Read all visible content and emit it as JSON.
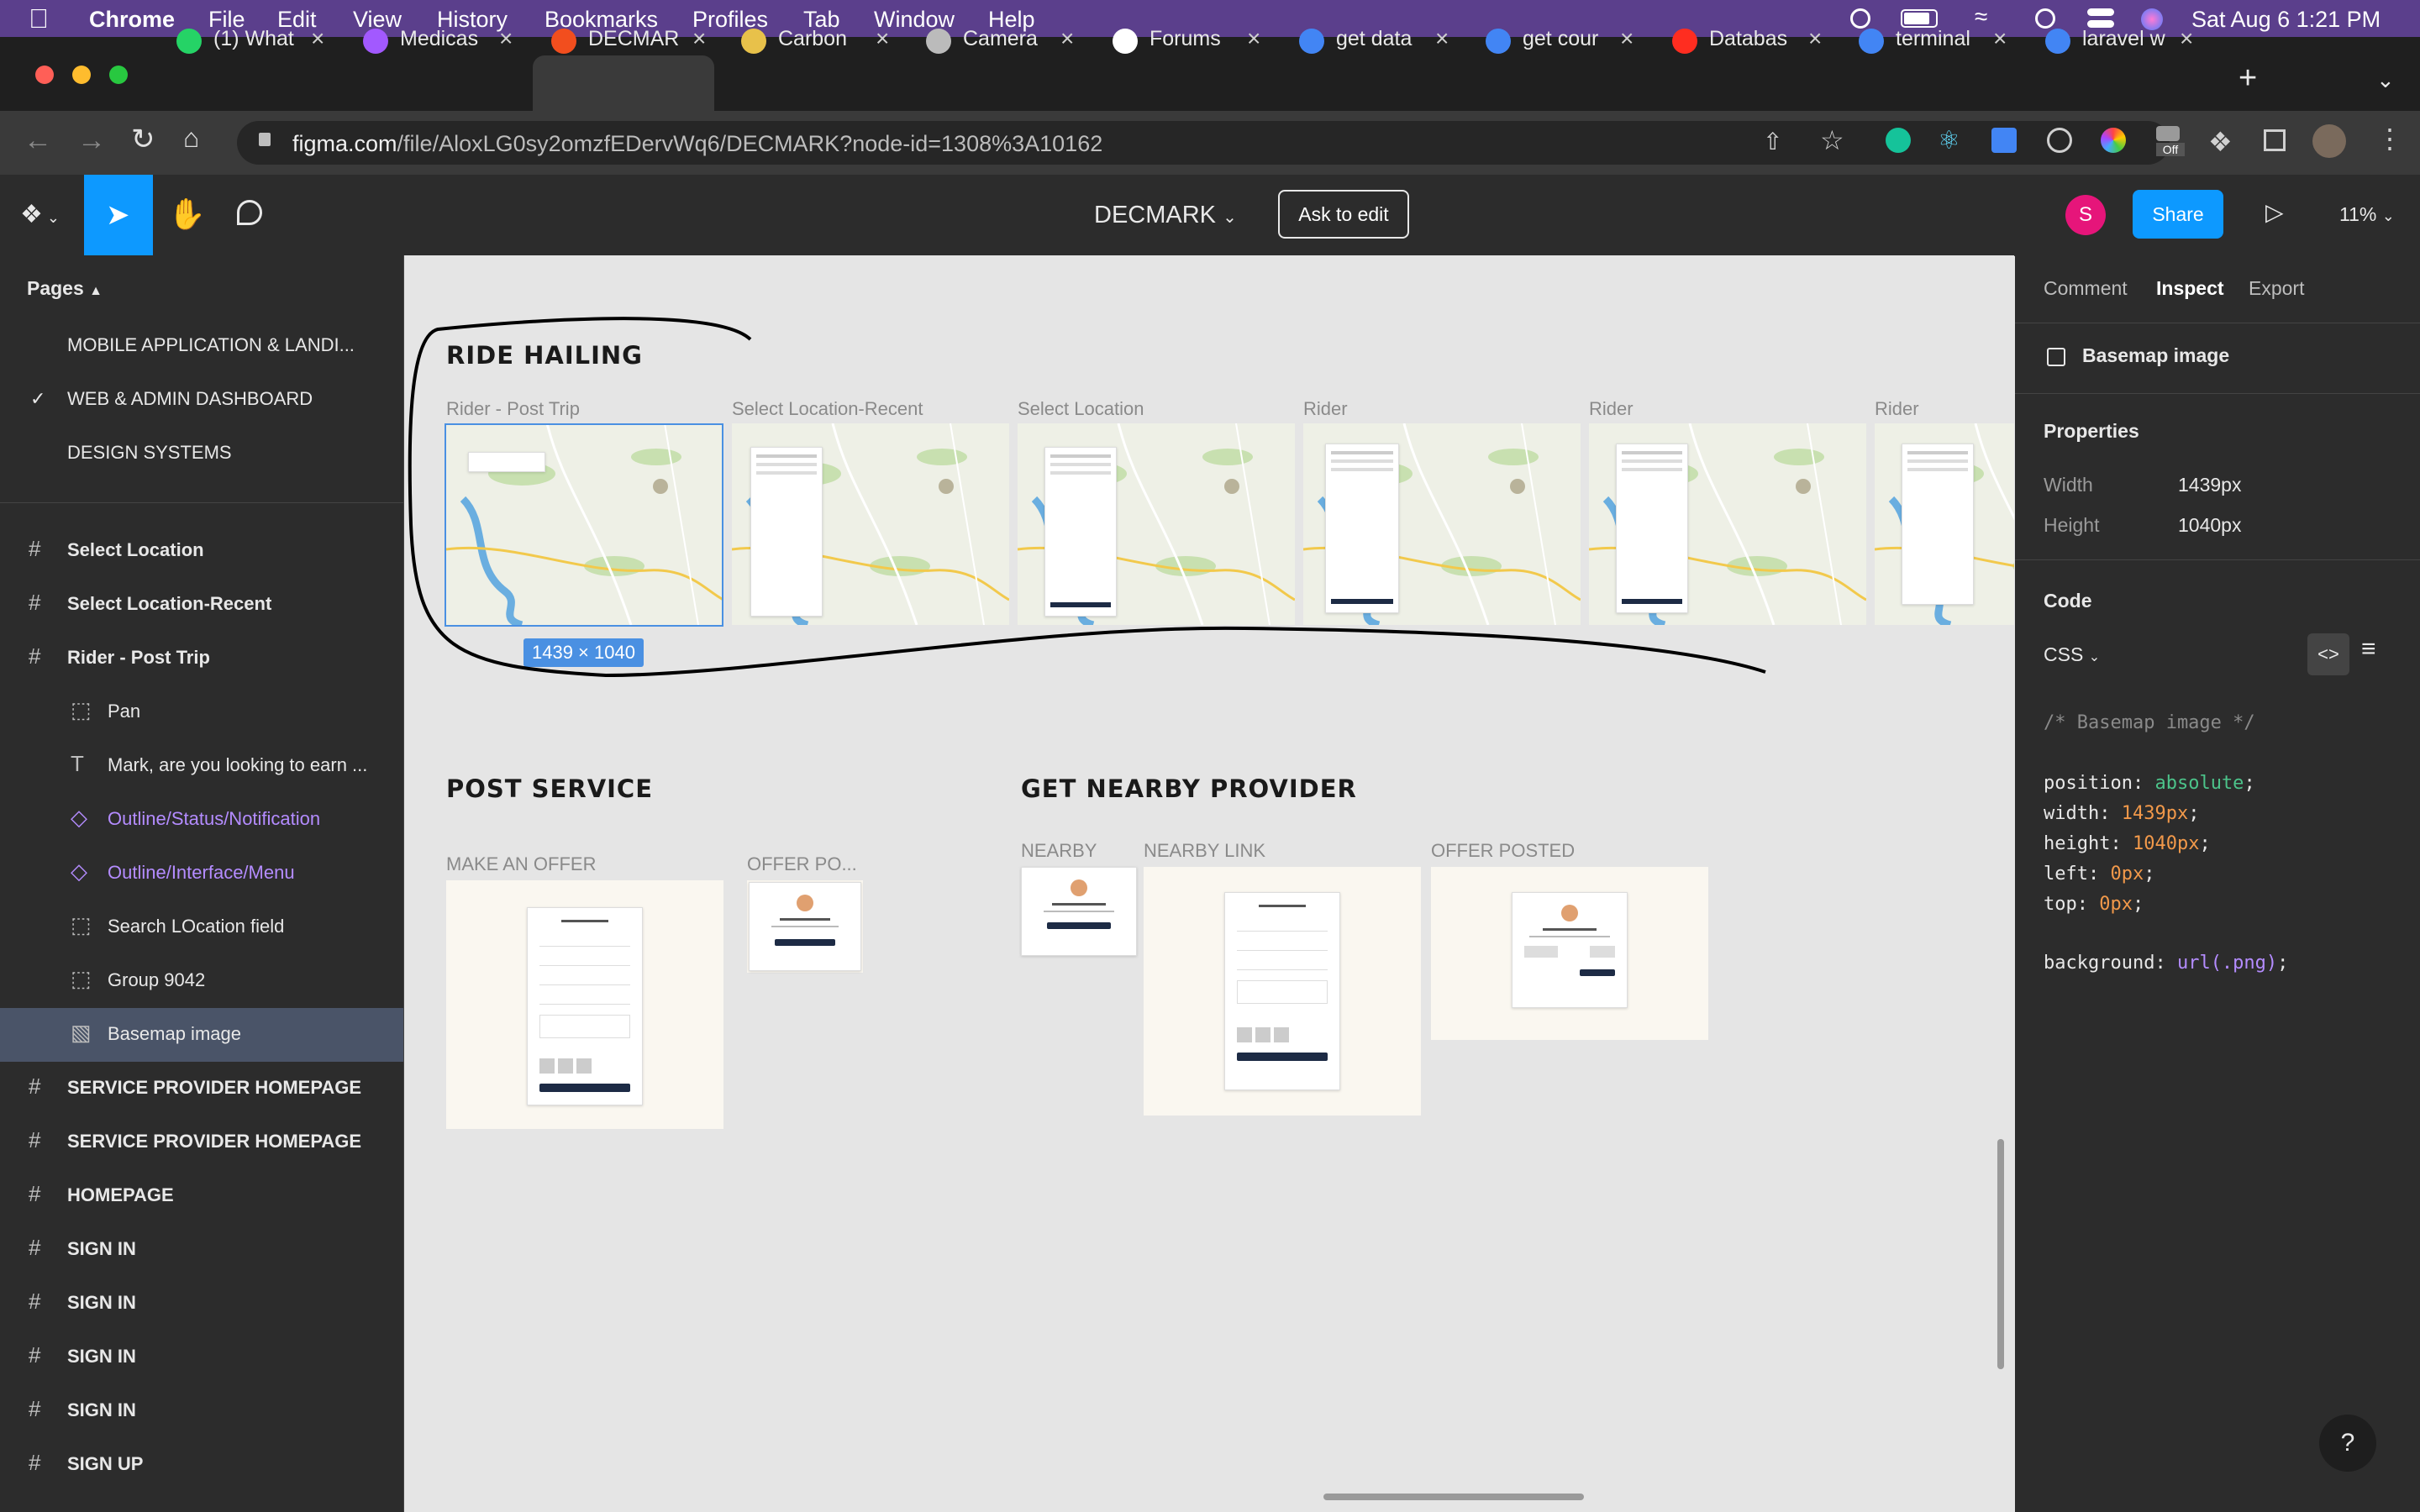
{
  "menubar": {
    "app": "Chrome",
    "items": [
      "File",
      "Edit",
      "View",
      "History",
      "Bookmarks",
      "Profiles",
      "Tab",
      "Window",
      "Help"
    ],
    "datetime": "Sat Aug 6  1:21 PM"
  },
  "tabs": [
    {
      "label": "(1) What",
      "color": "#25d366"
    },
    {
      "label": "Medicas",
      "color": "#a259ff"
    },
    {
      "label": "DECMAR",
      "color": "#f24e1e"
    },
    {
      "label": "Carbon",
      "color": "#e8c14a"
    },
    {
      "label": "Camera",
      "color": "#bbbbbb"
    },
    {
      "label": "Forums",
      "color": "#ffffff"
    },
    {
      "label": "get data",
      "color": "#4285f4"
    },
    {
      "label": "get cour",
      "color": "#4285f4"
    },
    {
      "label": "Databas",
      "color": "#ff2d20"
    },
    {
      "label": "terminal",
      "color": "#4285f4"
    },
    {
      "label": "laravel w",
      "color": "#4285f4"
    }
  ],
  "address": {
    "host": "figma.com",
    "path": "/file/AloxLG0sy2omzfEDervWq6/DECMARK?node-id=1308%3A10162"
  },
  "toolbar": {
    "file_name": "DECMARK",
    "ask_to_edit": "Ask to edit",
    "avatar_letter": "S",
    "share": "Share",
    "zoom": "11%"
  },
  "pages": {
    "header": "Pages",
    "items": [
      {
        "label": "MOBILE APPLICATION & LANDI...",
        "selected": false
      },
      {
        "label": "WEB & ADMIN DASHBOARD",
        "selected": true
      },
      {
        "label": "DESIGN SYSTEMS",
        "selected": false
      }
    ]
  },
  "layers": [
    {
      "label": "Select Location",
      "icon": "frame-icon",
      "indent": 0
    },
    {
      "label": "Select Location-Recent",
      "icon": "frame-icon",
      "indent": 0
    },
    {
      "label": "Rider - Post Trip",
      "icon": "frame-icon",
      "indent": 0
    },
    {
      "label": "Pan",
      "icon": "group-icon",
      "indent": 1
    },
    {
      "label": "Mark, are you looking to earn ...",
      "icon": "text-icon",
      "indent": 1
    },
    {
      "label": "Outline/Status/Notification",
      "icon": "component-icon",
      "indent": 1
    },
    {
      "label": "Outline/Interface/Menu",
      "icon": "component-icon",
      "indent": 1
    },
    {
      "label": "Search LOcation field",
      "icon": "group-icon",
      "indent": 1
    },
    {
      "label": "Group 9042",
      "icon": "group-icon",
      "indent": 1
    },
    {
      "label": "Basemap image",
      "icon": "image-icon",
      "indent": 1,
      "selected": true
    },
    {
      "label": "SERVICE PROVIDER HOMEPAGE",
      "icon": "frame-icon",
      "indent": 0
    },
    {
      "label": "SERVICE PROVIDER HOMEPAGE",
      "icon": "frame-icon",
      "indent": 0
    },
    {
      "label": "HOMEPAGE",
      "icon": "frame-icon",
      "indent": 0
    },
    {
      "label": "SIGN IN",
      "icon": "frame-icon",
      "indent": 0
    },
    {
      "label": "SIGN IN",
      "icon": "frame-icon",
      "indent": 0
    },
    {
      "label": "SIGN IN",
      "icon": "frame-icon",
      "indent": 0
    },
    {
      "label": "SIGN IN",
      "icon": "frame-icon",
      "indent": 0
    },
    {
      "label": "SIGN UP",
      "icon": "frame-icon",
      "indent": 0
    }
  ],
  "canvas": {
    "section1_title": "RIDE HAILING",
    "ride_frames": [
      "Rider - Post Trip",
      "Select Location-Recent",
      "Select Location",
      "Rider",
      "Rider",
      "Rider"
    ],
    "selection_size": "1439 × 1040",
    "section2_title": "POST SERVICE",
    "section3_title": "GET NEARBY PROVIDER",
    "post_frames": [
      "MAKE AN OFFER",
      "OFFER PO..."
    ],
    "nearby_frames": [
      "NEARBY",
      "NEARBY LINK",
      "OFFER POSTED"
    ]
  },
  "inspect": {
    "tabs": [
      "Comment",
      "Inspect",
      "Export"
    ],
    "active_tab": "Inspect",
    "layer_name": "Basemap image",
    "properties_title": "Properties",
    "width_label": "Width",
    "width_value": "1439px",
    "height_label": "Height",
    "height_value": "1040px",
    "code_title": "Code",
    "language": "CSS",
    "code_comment": "/* Basemap image */",
    "css": [
      {
        "prop": "position",
        "value": "absolute"
      },
      {
        "prop": "width",
        "value": "1439px"
      },
      {
        "prop": "height",
        "value": "1040px"
      },
      {
        "prop": "left",
        "value": "0px"
      },
      {
        "prop": "top",
        "value": "0px"
      }
    ],
    "background_prop": "background",
    "background_value": "url(.png)"
  },
  "colors": {
    "accent": "#0d99ff",
    "selection": "#4a90e2",
    "menubar": "#5b3f8c",
    "avatar": "#e6157a"
  }
}
